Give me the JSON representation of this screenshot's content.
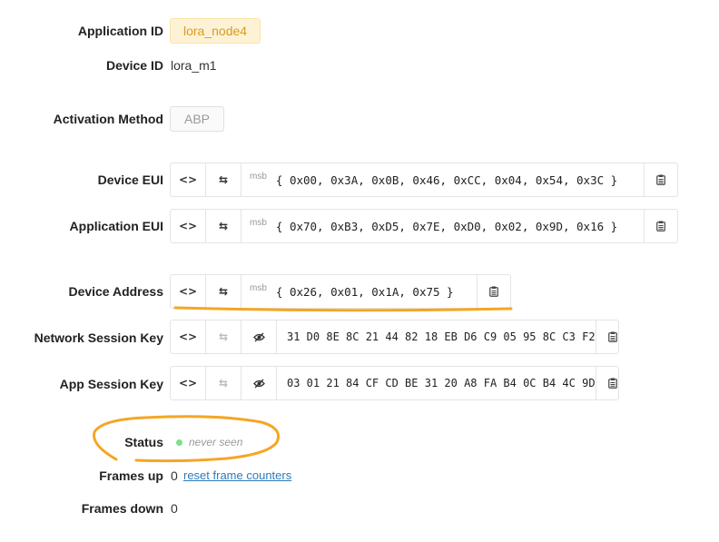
{
  "fields": {
    "application_id": {
      "label": "Application ID",
      "value": "lora_node4"
    },
    "device_id": {
      "label": "Device ID",
      "value": "lora_m1"
    },
    "activation_method": {
      "label": "Activation Method",
      "value": "ABP"
    },
    "device_eui": {
      "label": "Device EUI",
      "byte_order": "msb",
      "value": "{ 0x00, 0x3A, 0x0B, 0x46, 0xCC, 0x04, 0x54, 0x3C }"
    },
    "application_eui": {
      "label": "Application EUI",
      "byte_order": "msb",
      "value": "{ 0x70, 0xB3, 0xD5, 0x7E, 0xD0, 0x02, 0x9D, 0x16 }"
    },
    "device_address": {
      "label": "Device Address",
      "byte_order": "msb",
      "value": "{ 0x26, 0x01, 0x1A, 0x75 }"
    },
    "network_session_key": {
      "label": "Network Session Key",
      "value": "31 D0 8E 8C 21 44 82 18 EB D6 C9 05 95 8C C3 F2"
    },
    "app_session_key": {
      "label": "App Session Key",
      "value": "03 01 21 84 CF CD BE 31 20 A8 FA B4 0C B4 4C 9D"
    },
    "status": {
      "label": "Status",
      "value": "never seen"
    },
    "frames_up": {
      "label": "Frames up",
      "value": "0",
      "link": "reset frame counters"
    },
    "frames_down": {
      "label": "Frames down",
      "value": "0"
    }
  },
  "icons": {
    "code": "<>",
    "swap": "⇆",
    "hide": "eye-slash-icon",
    "copy": "clipboard-icon"
  },
  "colors": {
    "accent": "#f5a623",
    "link": "#2f7ab8",
    "status_dot": "#7de08a",
    "app_tag_bg": "#fdf2d6",
    "app_tag_text": "#d99c1e"
  }
}
